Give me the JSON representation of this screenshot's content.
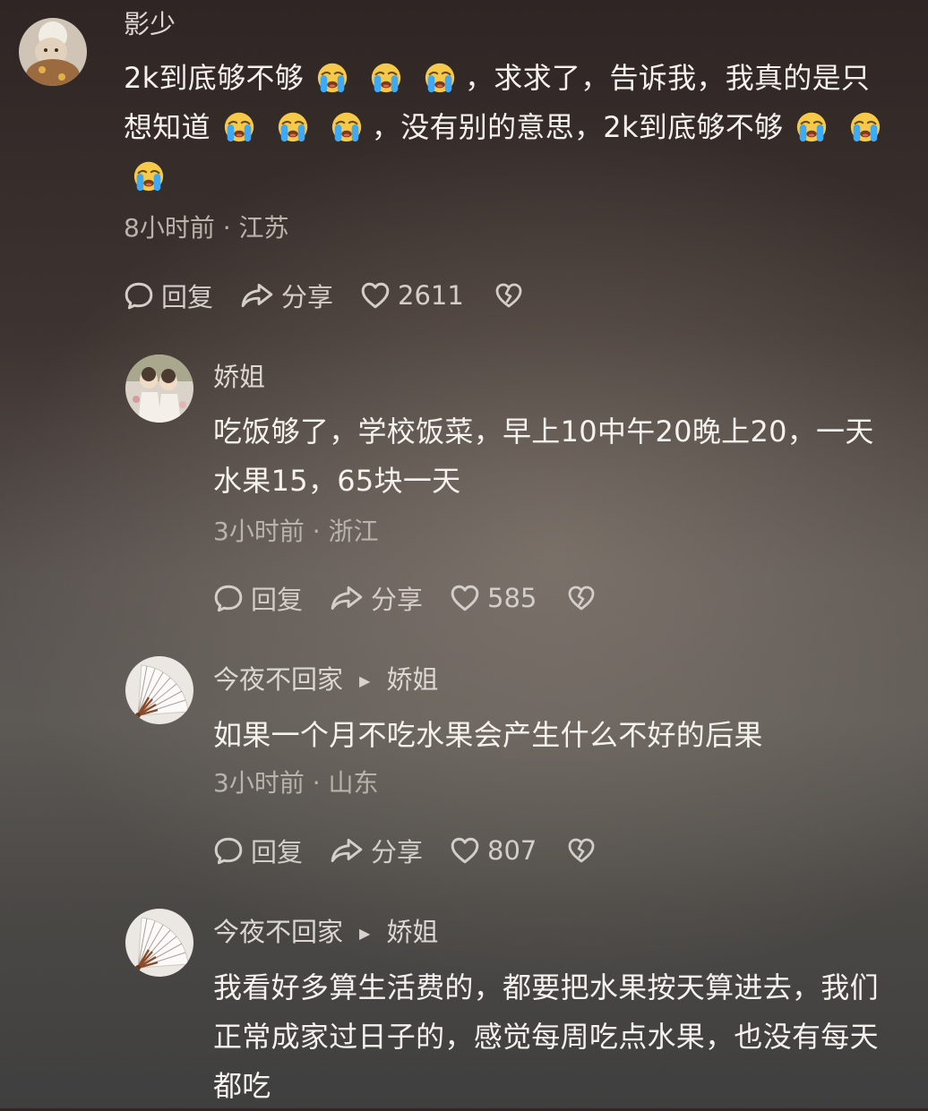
{
  "comments": [
    {
      "username": "影少",
      "segments": {
        "s1": "2k到底够不够",
        "s2": "，求求了，告诉我，我真的是只",
        "s3": "想知道",
        "s4": "，没有别的意思，2k到底够不够"
      },
      "time": "8小时前",
      "location": "江苏",
      "reply_label": "回复",
      "share_label": "分享",
      "likes": "2611"
    },
    {
      "username": "娇姐",
      "text_lines": [
        "吃饭够了，学校饭菜，早上10中午20晚上20，一天",
        "水果15，65块一天"
      ],
      "time": "3小时前",
      "location": "浙江",
      "reply_label": "回复",
      "share_label": "分享",
      "likes": "585"
    },
    {
      "username": "今夜不回家",
      "reply_to": "娇姐",
      "text_lines": [
        "如果一个月不吃水果会产生什么不好的后果"
      ],
      "time": "3小时前",
      "location": "山东",
      "reply_label": "回复",
      "share_label": "分享",
      "likes": "807"
    },
    {
      "username": "今夜不回家",
      "reply_to": "娇姐",
      "text_lines": [
        "我看好多算生活费的，都要把水果按天算进去，我们",
        "正常成家过日子的，感觉每周吃点水果，也没有每天",
        "都吃"
      ]
    }
  ],
  "separator": "·",
  "icons": {
    "emoji": "loudly-crying-face-icon",
    "reply": "speech-bubble-icon",
    "share": "share-arrow-icon",
    "like": "heart-icon",
    "dislike": "broken-heart-icon",
    "reply_to": "triangle-right-icon"
  },
  "colors": {
    "text": "#f5f2ee",
    "username": "#dcd7d2",
    "meta": "#b9b3ad"
  }
}
